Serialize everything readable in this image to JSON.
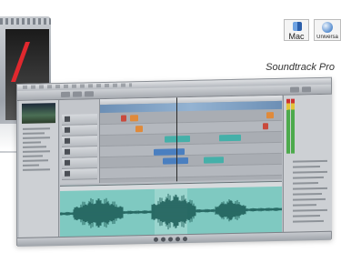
{
  "badges": {
    "mac_label": "Mac",
    "universal_label": "Universa"
  },
  "product": {
    "title": "Soundtrack Pro"
  },
  "app": {
    "window_title": ""
  },
  "colors": {
    "waveform_bg": "#7fc9c1",
    "waveform_stroke": "#1f5f5a",
    "clip_orange": "#e08a3a",
    "clip_blue": "#4a7fc0",
    "clip_teal": "#45b0a9"
  },
  "icons": [
    "mac-finder-icon",
    "universal-binary-icon"
  ]
}
